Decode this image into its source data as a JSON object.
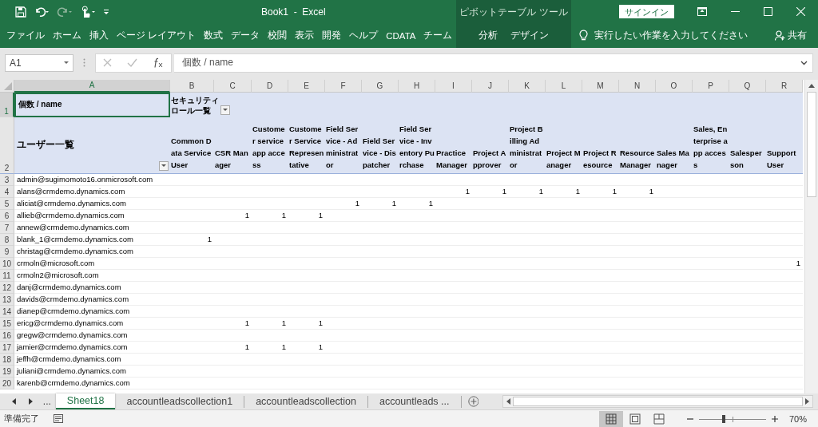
{
  "window": {
    "title": "Book1  -  Excel",
    "contextual_group": "ピボットテーブル ツール",
    "sign_in": "サインイン"
  },
  "ribbon_tabs": [
    {
      "label": "ファイル",
      "contextual": false
    },
    {
      "label": "ホーム",
      "contextual": false
    },
    {
      "label": "挿入",
      "contextual": false
    },
    {
      "label": "ページ レイアウト",
      "contextual": false
    },
    {
      "label": "数式",
      "contextual": false
    },
    {
      "label": "データ",
      "contextual": false
    },
    {
      "label": "校閲",
      "contextual": false
    },
    {
      "label": "表示",
      "contextual": false
    },
    {
      "label": "開発",
      "contextual": false
    },
    {
      "label": "ヘルプ",
      "contextual": false
    },
    {
      "label": "CDATA",
      "contextual": false
    },
    {
      "label": "チーム",
      "contextual": false
    },
    {
      "label": "分析",
      "contextual": true
    },
    {
      "label": "デザイン",
      "contextual": true
    }
  ],
  "tell_me": "実行したい作業を入力してください",
  "share": "共有",
  "formula_bar": {
    "name_box": "A1",
    "formula": "個数 / name"
  },
  "columns": [
    {
      "letter": "A",
      "selected": true
    },
    {
      "letter": "B",
      "selected": false
    },
    {
      "letter": "C",
      "selected": false
    },
    {
      "letter": "D",
      "selected": false
    },
    {
      "letter": "E",
      "selected": false
    },
    {
      "letter": "F",
      "selected": false
    },
    {
      "letter": "G",
      "selected": false
    },
    {
      "letter": "H",
      "selected": false
    },
    {
      "letter": "I",
      "selected": false
    },
    {
      "letter": "J",
      "selected": false
    },
    {
      "letter": "K",
      "selected": false
    },
    {
      "letter": "L",
      "selected": false
    },
    {
      "letter": "M",
      "selected": false
    },
    {
      "letter": "N",
      "selected": false
    },
    {
      "letter": "O",
      "selected": false
    },
    {
      "letter": "P",
      "selected": false
    },
    {
      "letter": "Q",
      "selected": false
    },
    {
      "letter": "R",
      "selected": false
    }
  ],
  "pivot": {
    "header_rows": [
      {
        "number": "1",
        "selected": true
      },
      {
        "number": "2",
        "selected": false
      }
    ],
    "corner_label": "個数 / name",
    "column_field": "セキュリティロール一覧",
    "row_field": "ユーザー一覧",
    "headers": [
      "Common Data Service User",
      "CSR Manager",
      "Customer service app access",
      "Customer Service Representative",
      "Field Service - Administrator",
      "Field Service - Dispatcher",
      "Field Service - Inventory Purchase",
      "Practice Manager",
      "Project Approver",
      "Project Billing Administrator",
      "Project Manager",
      "Project Resource",
      "Resource Manager",
      "Sales Manager",
      "Sales, Enterprise app access",
      "Salesperson",
      "Support User"
    ],
    "rows": [
      {
        "number": "3",
        "email": "admin@sugimomoto16.onmicrosoft.com"
      },
      {
        "number": "4",
        "email": "alans@crmdemo.dynamics.com",
        "counts": {
          "I": "1",
          "J": "1",
          "K": "1",
          "L": "1",
          "M": "1",
          "N": "1"
        }
      },
      {
        "number": "5",
        "email": "aliciat@crmdemo.dynamics.com",
        "counts": {
          "F": "1",
          "G": "1",
          "H": "1"
        }
      },
      {
        "number": "6",
        "email": "allieb@crmdemo.dynamics.com",
        "counts": {
          "C": "1",
          "D": "1",
          "E": "1"
        }
      },
      {
        "number": "7",
        "email": "annew@crmdemo.dynamics.com"
      },
      {
        "number": "8",
        "email": "blank_1@crmdemo.dynamics.com",
        "counts": {
          "B": "1"
        }
      },
      {
        "number": "9",
        "email": "christag@crmdemo.dynamics.com"
      },
      {
        "number": "10",
        "email": "crmoln@microsoft.com",
        "counts": {
          "R": "1"
        }
      },
      {
        "number": "11",
        "email": "crmoln2@microsoft.com"
      },
      {
        "number": "12",
        "email": "danj@crmdemo.dynamics.com"
      },
      {
        "number": "13",
        "email": "davids@crmdemo.dynamics.com"
      },
      {
        "number": "14",
        "email": "dianep@crmdemo.dynamics.com"
      },
      {
        "number": "15",
        "email": "ericg@crmdemo.dynamics.com",
        "counts": {
          "C": "1",
          "D": "1",
          "E": "1"
        }
      },
      {
        "number": "16",
        "email": "gregw@crmdemo.dynamics.com"
      },
      {
        "number": "17",
        "email": "jamier@crmdemo.dynamics.com",
        "counts": {
          "C": "1",
          "D": "1",
          "E": "1"
        }
      },
      {
        "number": "18",
        "email": "jeffh@crmdemo.dynamics.com"
      },
      {
        "number": "19",
        "email": "juliani@crmdemo.dynamics.com"
      },
      {
        "number": "20",
        "email": "karenb@crmdemo.dynamics.com"
      }
    ]
  },
  "sheet_nav_more": "...",
  "sheet_tabs": [
    {
      "label": "Sheet18",
      "selected": true
    },
    {
      "label": "accountleadscollection1",
      "selected": false
    },
    {
      "label": "accountleadscollection",
      "selected": false
    },
    {
      "label": "accountleads ...",
      "selected": false
    }
  ],
  "status": {
    "text": "準備完了",
    "zoom": "70%",
    "zoom_slider": {
      "level": 0.37
    }
  }
}
